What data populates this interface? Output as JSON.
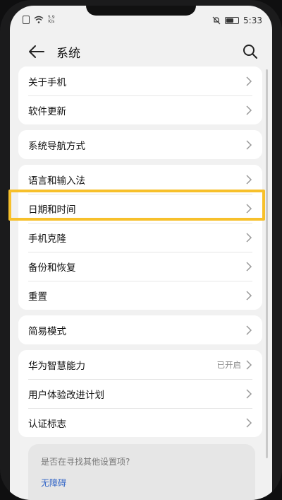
{
  "status_bar": {
    "net_speed_top": "5.9",
    "net_speed_bottom": "K/s",
    "time": "5:33"
  },
  "header": {
    "title": "系统"
  },
  "groups": [
    {
      "items": [
        {
          "label": "关于手机"
        },
        {
          "label": "软件更新"
        }
      ]
    },
    {
      "items": [
        {
          "label": "系统导航方式"
        }
      ]
    },
    {
      "items": [
        {
          "label": "语言和输入法"
        },
        {
          "label": "日期和时间"
        },
        {
          "label": "手机克隆"
        },
        {
          "label": "备份和恢复"
        },
        {
          "label": "重置"
        }
      ]
    },
    {
      "items": [
        {
          "label": "简易模式"
        }
      ]
    },
    {
      "items": [
        {
          "label": "华为智慧能力",
          "value": "已开启"
        },
        {
          "label": "用户体验改进计划"
        },
        {
          "label": "认证标志"
        }
      ]
    }
  ],
  "suggest": {
    "title": "是否在寻找其他设置项?",
    "link": "无障碍"
  },
  "colors": {
    "highlight": "#f7c02b",
    "link": "#2f63c6"
  },
  "icons": [
    "back-arrow-icon",
    "search-icon",
    "chevron-right-icon",
    "wifi-icon",
    "mute-icon",
    "battery-icon"
  ]
}
